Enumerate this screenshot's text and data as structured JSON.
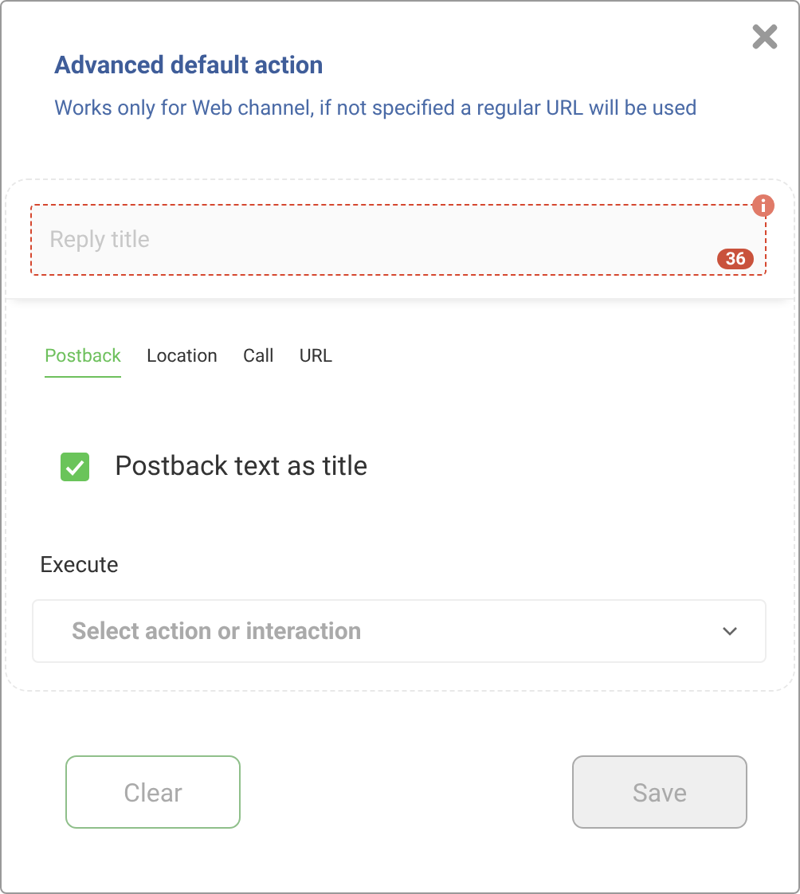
{
  "dialog": {
    "title": "Advanced default action",
    "subtitle": "Works only for Web channel, if not specified a regular URL will be used"
  },
  "reply_title": {
    "placeholder": "Reply title",
    "counter": "36",
    "error": true
  },
  "tabs": [
    {
      "label": "Postback",
      "selected": true
    },
    {
      "label": "Location",
      "selected": false
    },
    {
      "label": "Call",
      "selected": false
    },
    {
      "label": "URL",
      "selected": false
    }
  ],
  "checkbox": {
    "label": "Postback text as title",
    "checked": true
  },
  "execute": {
    "label": "Execute",
    "placeholder": "Select action or interaction"
  },
  "buttons": [
    {
      "label": "Clear",
      "kind": "secondary",
      "disabled": false
    },
    {
      "label": "Save",
      "kind": "primary",
      "disabled": true
    }
  ]
}
